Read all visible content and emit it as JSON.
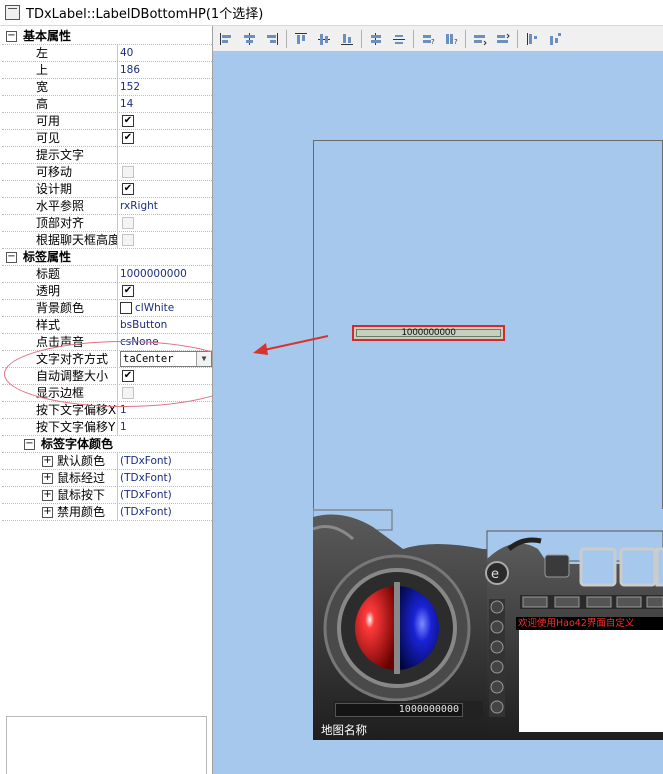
{
  "window": {
    "title": "TDxLabel::LabelDBottomHP(1个选择)"
  },
  "inspector": {
    "basic": {
      "title": "基本属性",
      "left": {
        "k": "左",
        "v": "40"
      },
      "top": {
        "k": "上",
        "v": "186"
      },
      "width": {
        "k": "宽",
        "v": "152"
      },
      "height": {
        "k": "高",
        "v": "14"
      },
      "enabled": {
        "k": "可用",
        "v": true
      },
      "visible": {
        "k": "可见",
        "v": true
      },
      "hint": {
        "k": "提示文字",
        "v": ""
      },
      "movable": {
        "k": "可移动",
        "v": false
      },
      "design": {
        "k": "设计期",
        "v": true
      },
      "hanchor": {
        "k": "水平参照",
        "v": "rxRight"
      },
      "topalign": {
        "k": "顶部对齐",
        "v": false
      },
      "chatfit": {
        "k": "根据聊天框高度",
        "v": false
      }
    },
    "label": {
      "title": "标签属性",
      "caption": {
        "k": "标题",
        "v": "1000000000"
      },
      "transparent": {
        "k": "透明",
        "v": true
      },
      "bgcolor": {
        "k": "背景颜色",
        "v": "clWhite"
      },
      "style": {
        "k": "样式",
        "v": "bsButton"
      },
      "sound": {
        "k": "点击声音",
        "v": "csNone"
      },
      "align": {
        "k": "文字对齐方式",
        "v": "taCenter"
      },
      "autosize": {
        "k": "自动调整大小",
        "v": true
      },
      "border": {
        "k": "显示边框",
        "v": false
      },
      "offx": {
        "k": "按下文字偏移X",
        "v": "1"
      },
      "offy": {
        "k": "按下文字偏移Y",
        "v": "1"
      }
    },
    "fontcolors": {
      "title": "标签字体颜色",
      "default": {
        "k": "默认颜色",
        "v": "(TDxFont)"
      },
      "hover": {
        "k": "鼠标经过",
        "v": "(TDxFont)"
      },
      "down": {
        "k": "鼠标按下",
        "v": "(TDxFont)"
      },
      "disabled": {
        "k": "禁用颜色",
        "v": "(TDxFont)"
      }
    }
  },
  "toolbar": {
    "icons": [
      "align-left-icon",
      "align-center-h-icon",
      "align-right-icon",
      "align-top-icon",
      "align-center-v-icon",
      "align-bottom-icon",
      "space-equal-h-icon",
      "space-equal-v-icon",
      "size-width-icon",
      "size-height-icon",
      "bring-front-icon",
      "send-back-icon",
      "lock-icon",
      "unlock-icon"
    ]
  },
  "designer": {
    "selected_label_text": "1000000000",
    "hp_readout": "1000000000",
    "chat_header": "欢迎使用Hao42界面自定义",
    "map_name": "地图名称"
  },
  "colors": {
    "canvas": "#a6c8ec",
    "selection": "#d42a2a",
    "annotation": "#e07080"
  }
}
